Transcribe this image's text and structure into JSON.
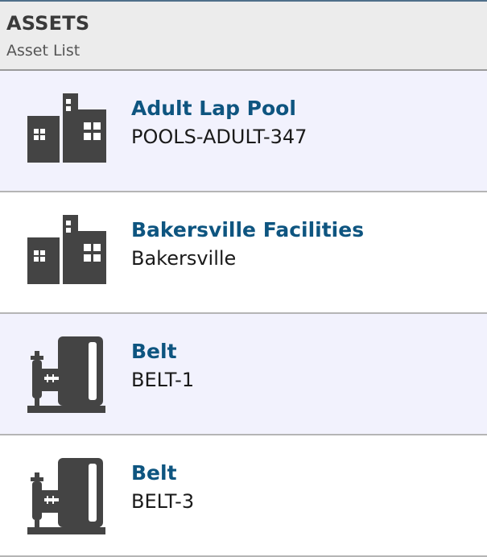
{
  "header": {
    "title": "ASSETS",
    "subtitle": "Asset List"
  },
  "colors": {
    "name_text": "#0e5580",
    "icon": "#444444",
    "row_alt_bg": "#f2f2fd"
  },
  "assets": [
    {
      "name": "Adult Lap Pool",
      "code": "POOLS-ADULT-347",
      "icon": "building-icon"
    },
    {
      "name": "Bakersville Facilities",
      "code": "Bakersville",
      "icon": "building-icon"
    },
    {
      "name": "Belt",
      "code": "BELT-1",
      "icon": "equipment-icon"
    },
    {
      "name": "Belt",
      "code": "BELT-3",
      "icon": "equipment-icon"
    }
  ]
}
